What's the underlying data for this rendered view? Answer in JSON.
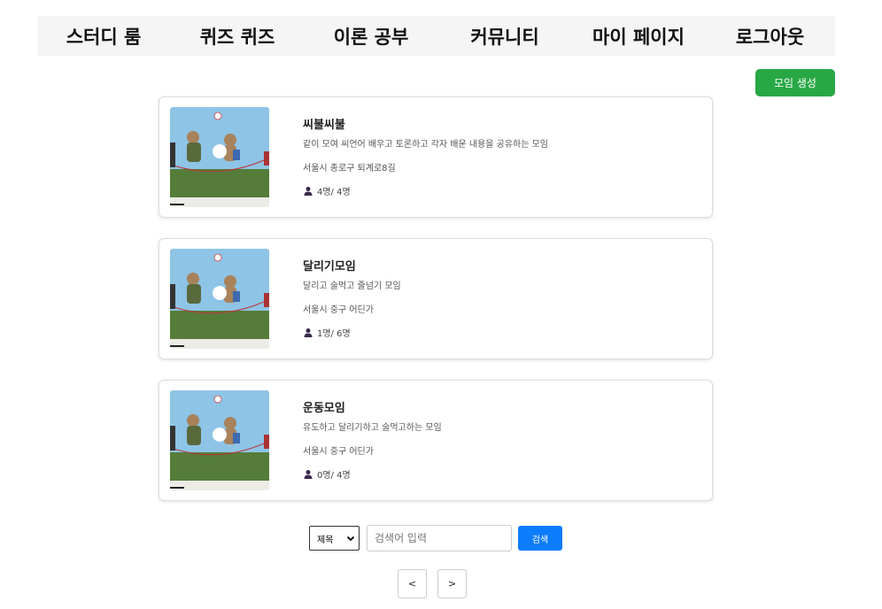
{
  "nav": {
    "items": [
      {
        "label": "스터디 룸"
      },
      {
        "label": "퀴즈 퀴즈"
      },
      {
        "label": "이론 공부"
      },
      {
        "label": "커뮤니티"
      },
      {
        "label": "마이 페이지"
      },
      {
        "label": "로그아웃"
      }
    ]
  },
  "create_button": {
    "label": "모임 생성",
    "color": "#28a745"
  },
  "groups": [
    {
      "title": "씨불씨불",
      "description": "같이 모여 씨언어 배우고 토론하고 각자 배운 내용을 공유하는 모임",
      "location": "서울시 종로구 퇴계로8길",
      "members": "4명/ 4명",
      "thumbnail_icon": "bears-jump-rope-image"
    },
    {
      "title": "달리기모임",
      "description": "달리고 술먹고 줄넘기 모임",
      "location": "서울시 중구 어딘가",
      "members": "1명/ 6명",
      "thumbnail_icon": "bears-jump-rope-image"
    },
    {
      "title": "운동모임",
      "description": "유도하고 달리기하고 술먹고하는 모임",
      "location": "서울시 중구 어딘가",
      "members": "0명/ 4명",
      "thumbnail_icon": "bears-jump-rope-image"
    }
  ],
  "search": {
    "select_value": "제목",
    "placeholder": "검색어 입력",
    "button_label": "검색",
    "button_color": "#0d7dfb"
  },
  "pagination": {
    "prev_label": "<",
    "next_label": ">"
  }
}
